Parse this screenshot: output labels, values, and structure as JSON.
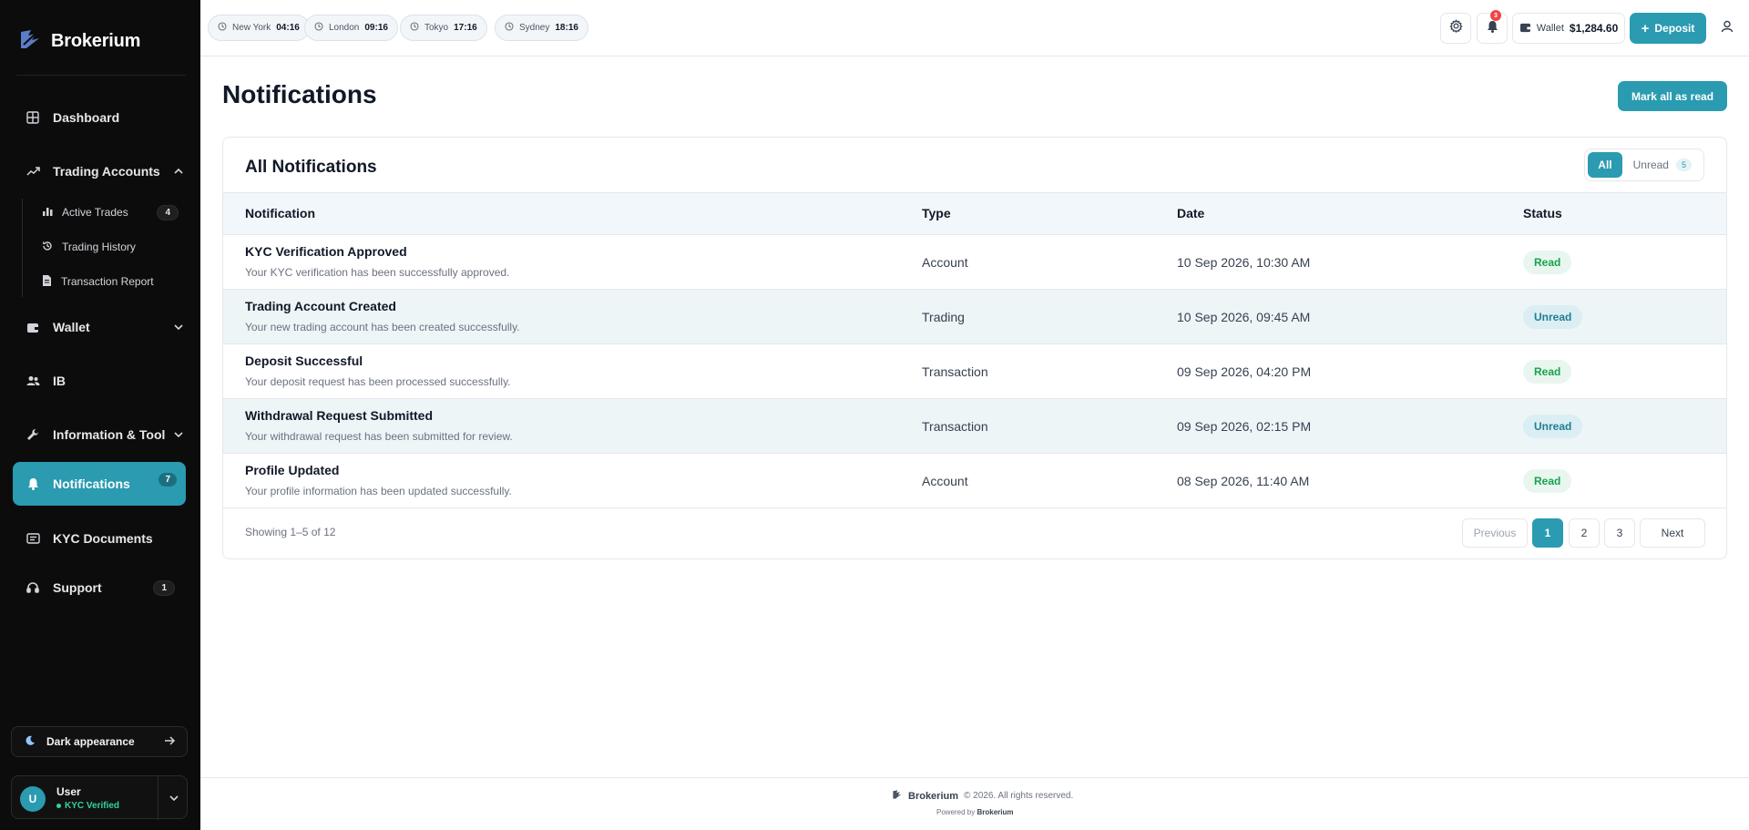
{
  "brand": {
    "name": "Brokerium"
  },
  "sidebar": {
    "items": [
      {
        "label": "Dashboard",
        "icon": "grid-icon"
      },
      {
        "label": "Trading Accounts",
        "icon": "trending-up-icon"
      },
      {
        "label": "Wallet",
        "icon": "wallet-icon"
      },
      {
        "label": "IB",
        "icon": "users-icon"
      },
      {
        "label": "Information & Tool",
        "icon": "wrench-icon"
      },
      {
        "label": "Notifications",
        "icon": "bell-icon",
        "badge": "7"
      },
      {
        "label": "KYC Documents",
        "icon": "id-card-icon"
      },
      {
        "label": "Support",
        "icon": "headset-icon",
        "badge": "1"
      }
    ],
    "subitems": [
      {
        "label": "Active Trades",
        "icon": "bar-chart-icon",
        "badge": "4"
      },
      {
        "label": "Trading History",
        "icon": "history-icon"
      },
      {
        "label": "Transaction Report",
        "icon": "file-icon"
      }
    ],
    "dark_toggle": "Dark appearance",
    "user": {
      "initial": "U",
      "name": "User",
      "kyc": "KYC Verified"
    }
  },
  "topbar": {
    "clocks": [
      {
        "city": "New York",
        "time": "04:16"
      },
      {
        "city": "London",
        "time": "09:16"
      },
      {
        "city": "Tokyo",
        "time": "17:16"
      },
      {
        "city": "Sydney",
        "time": "18:16"
      }
    ],
    "notif_count": "3",
    "wallet_label": "Wallet",
    "wallet_amount": "$1,284.60",
    "deposit_label": "Deposit"
  },
  "main": {
    "title": "Notifications",
    "mark_all": "Mark all as read",
    "card_title": "All Notifications",
    "filter": {
      "all": "All",
      "unread": "Unread",
      "unread_count": "5"
    },
    "columns": [
      "Notification",
      "Type",
      "Date",
      "Status"
    ],
    "rows": [
      {
        "title": "KYC Verification Approved",
        "desc": "Your KYC verification has been successfully approved.",
        "type": "Account",
        "date": "10 Sep 2026, 10:30 AM",
        "status": "Read"
      },
      {
        "title": "Trading Account Created",
        "desc": "Your new trading account has been created successfully.",
        "type": "Trading",
        "date": "10 Sep 2026, 09:45 AM",
        "status": "Unread"
      },
      {
        "title": "Deposit Successful",
        "desc": "Your deposit request has been processed successfully.",
        "type": "Transaction",
        "date": "09 Sep 2026, 04:20 PM",
        "status": "Read"
      },
      {
        "title": "Withdrawal Request Submitted",
        "desc": "Your withdrawal request has been submitted for review.",
        "type": "Transaction",
        "date": "09 Sep 2026, 02:15 PM",
        "status": "Unread"
      },
      {
        "title": "Profile Updated",
        "desc": "Your profile information has been updated successfully.",
        "type": "Account",
        "date": "08 Sep 2026, 11:40 AM",
        "status": "Read"
      }
    ],
    "showing": "Showing 1–5 of 12",
    "pagination": {
      "previous": "Previous",
      "pages": [
        "1",
        "2",
        "3"
      ],
      "next": "Next"
    }
  },
  "footer": {
    "brand": "Brokerium",
    "copyright": "© 2026. All rights reserved.",
    "powered_prefix": "Powered by",
    "powered_brand": "Brokerium"
  },
  "colors": {
    "accent": "#2a9bb0",
    "sidebar_bg": "#0c0c0c",
    "read": "#16a34a",
    "unread": "#1e7f92"
  }
}
